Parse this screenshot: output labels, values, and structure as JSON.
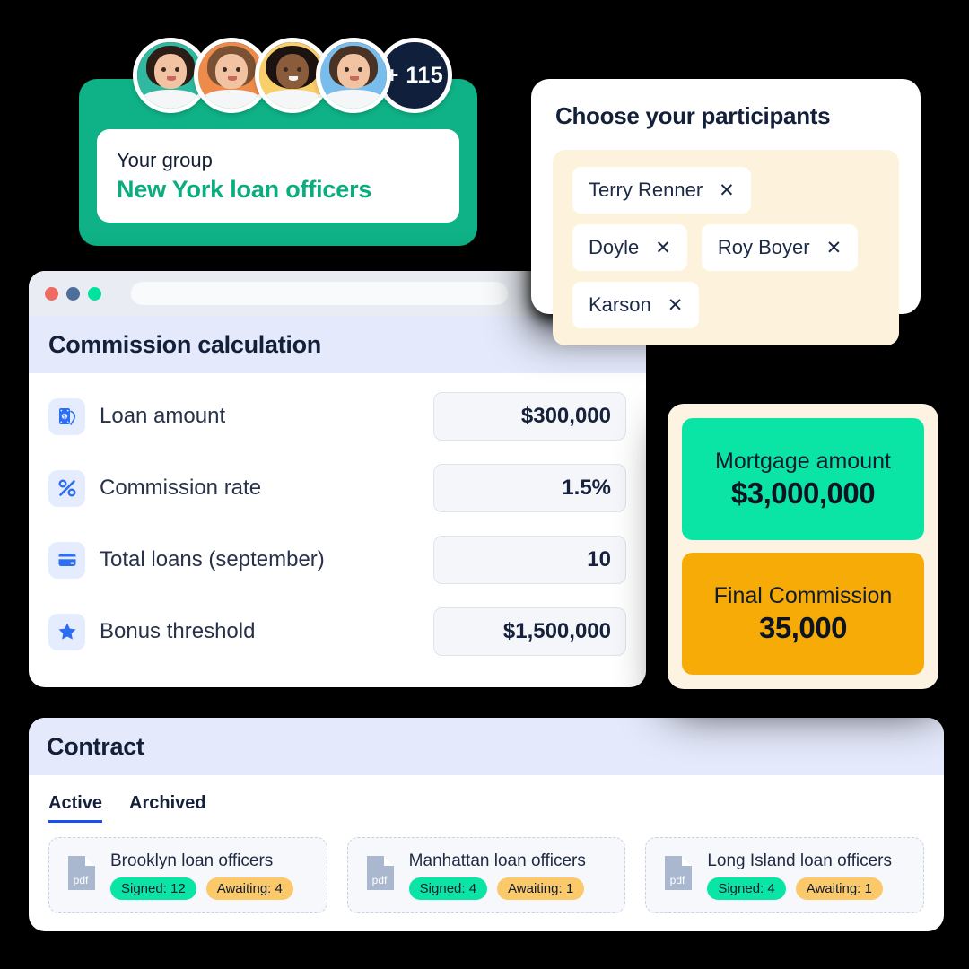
{
  "group_card": {
    "label": "Your group",
    "name": "New York loan officers",
    "more_count_label": "+ 115",
    "accent_color": "#0fb286",
    "name_color": "#0aad7e",
    "avatars": [
      {
        "name": "avatar-1",
        "bg": "#2fb9a0",
        "hair": "#2c1d17"
      },
      {
        "name": "avatar-2",
        "bg": "#ef8b4a",
        "hair": "#7b5134"
      },
      {
        "name": "avatar-3",
        "bg": "#f9cf6a",
        "hair": "#1c1210"
      },
      {
        "name": "avatar-4",
        "bg": "#79bdec",
        "hair": "#4a3224"
      }
    ]
  },
  "participants": {
    "title": "Choose your participants",
    "container_color": "#fdf3dc",
    "chips": [
      {
        "name": "Terry Renner",
        "remove": "✕"
      },
      {
        "name": "Doyle",
        "remove": "✕"
      },
      {
        "name": "Roy Boyer",
        "remove": "✕"
      },
      {
        "name": "Karson",
        "remove": "✕"
      }
    ]
  },
  "browser": {
    "dots": [
      "#ef6a60",
      "#4f6d99",
      "#00e39c"
    ],
    "url_value": "",
    "url_placeholder": ""
  },
  "commission_panel": {
    "title": "Commission calculation",
    "header_color": "#e4eafb",
    "rows": [
      {
        "icon": "banknote-icon",
        "label": "Loan amount",
        "value": "$300,000"
      },
      {
        "icon": "percent-icon",
        "label": "Commission rate",
        "value": "1.5%"
      },
      {
        "icon": "credit-card-icon",
        "label": "Total loans (september)",
        "value": "10"
      },
      {
        "icon": "star-icon",
        "label": "Bonus threshold",
        "value": "$1,500,000"
      }
    ]
  },
  "results": {
    "background": "#fdf3e3",
    "items": [
      {
        "label": "Mortgage amount",
        "value": "$3,000,000",
        "color": "#0ae5a5"
      },
      {
        "label": "Final Commission",
        "value": "35,000",
        "color": "#f7ab07"
      }
    ]
  },
  "contract": {
    "title": "Contract",
    "header_color": "#e4eafb",
    "tabs": [
      {
        "label": "Active",
        "active": true
      },
      {
        "label": "Archived",
        "active": false
      }
    ],
    "documents": [
      {
        "icon": "pdf-icon",
        "icon_label": "pdf",
        "name": "Brooklyn loan officers",
        "signed_label": "Signed: 12",
        "awaiting_label": "Awaiting: 4"
      },
      {
        "icon": "pdf-icon",
        "icon_label": "pdf",
        "name": "Manhattan loan officers",
        "signed_label": "Signed: 4",
        "awaiting_label": "Awaiting: 1"
      },
      {
        "icon": "pdf-icon",
        "icon_label": "pdf",
        "name": "Long Island loan officers",
        "signed_label": "Signed: 4",
        "awaiting_label": "Awaiting: 1"
      }
    ]
  },
  "colors": {
    "background": "#000000",
    "brand_green": "#0fb286",
    "accent_blue": "#2b6ef5",
    "tab_underline": "#1b4ef0",
    "badge_green": "#0ae5a5",
    "badge_amber": "#fbc96a"
  }
}
